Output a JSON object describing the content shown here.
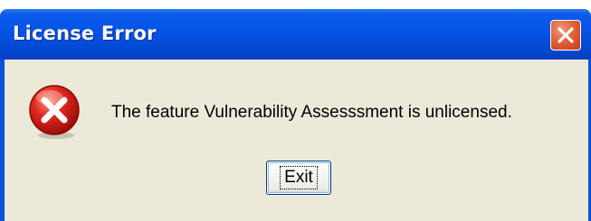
{
  "window": {
    "title": "License Error",
    "close_icon": "close-icon"
  },
  "dialog": {
    "icon": "error-icon",
    "message": "The feature Vulnerability Assesssment is unlicensed.",
    "exit_label": "Exit"
  },
  "colors": {
    "titlebar": "#0453e6",
    "close_button": "#e1623b",
    "client_background": "#ece9d8",
    "error_icon": "#d11c1c"
  }
}
